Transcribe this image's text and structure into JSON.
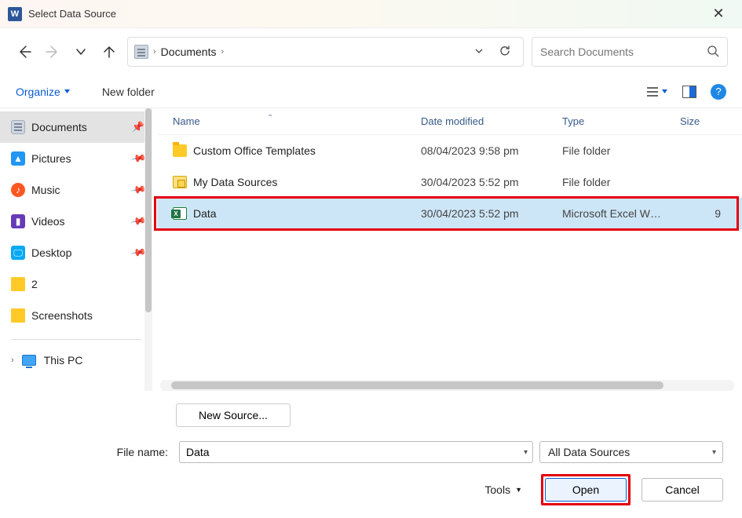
{
  "titlebar": {
    "app_letter": "W",
    "title": "Select Data Source"
  },
  "nav": {
    "path_label": "Documents",
    "search_placeholder": "Search Documents"
  },
  "toolbar": {
    "organize": "Organize",
    "new_folder": "New folder",
    "help_char": "?"
  },
  "sidebar": {
    "items": [
      {
        "label": "Documents",
        "icon": "doc",
        "active": true
      },
      {
        "label": "Pictures",
        "icon": "pic"
      },
      {
        "label": "Music",
        "icon": "mus"
      },
      {
        "label": "Videos",
        "icon": "vid"
      },
      {
        "label": "Desktop",
        "icon": "desk"
      },
      {
        "label": "2",
        "icon": "fold"
      },
      {
        "label": "Screenshots",
        "icon": "fold"
      }
    ],
    "this_pc": "This PC"
  },
  "columns": {
    "name": "Name",
    "date": "Date modified",
    "type": "Type",
    "size": "Size"
  },
  "files": [
    {
      "name": "Custom Office Templates",
      "date": "08/04/2023 9:58 pm",
      "type": "File folder",
      "size": "",
      "icon": "folder",
      "selected": false
    },
    {
      "name": "My Data Sources",
      "date": "30/04/2023 5:52 pm",
      "type": "File folder",
      "size": "",
      "icon": "dbfolder",
      "selected": false
    },
    {
      "name": "Data",
      "date": "30/04/2023 5:52 pm",
      "type": "Microsoft Excel W…",
      "size": "9",
      "icon": "excel",
      "selected": true
    }
  ],
  "bottom": {
    "new_source": "New Source...",
    "file_name_label": "File name:",
    "file_name_value": "Data",
    "filter": "All Data Sources",
    "tools": "Tools",
    "open": "Open",
    "cancel": "Cancel"
  }
}
